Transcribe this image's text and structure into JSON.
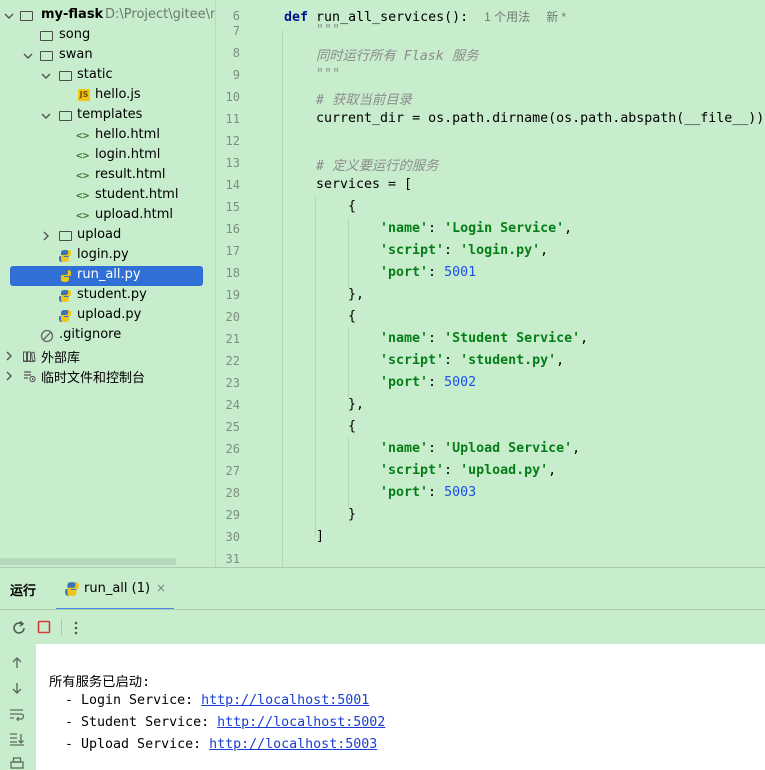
{
  "project_tree": {
    "root": {
      "name": "my-flask",
      "path": "D:\\Project\\gitee\\m"
    },
    "items": [
      {
        "name": "song",
        "type": "folder"
      },
      {
        "name": "swan",
        "type": "folder"
      },
      {
        "name": "static",
        "type": "folder"
      },
      {
        "name": "hello.js",
        "type": "js-file"
      },
      {
        "name": "templates",
        "type": "folder"
      },
      {
        "name": "hello.html",
        "type": "html-file"
      },
      {
        "name": "login.html",
        "type": "html-file"
      },
      {
        "name": "result.html",
        "type": "html-file"
      },
      {
        "name": "student.html",
        "type": "html-file"
      },
      {
        "name": "upload.html",
        "type": "html-file"
      },
      {
        "name": "upload",
        "type": "folder"
      },
      {
        "name": "login.py",
        "type": "python-file"
      },
      {
        "name": "run_all.py",
        "type": "python-file",
        "selected": true
      },
      {
        "name": "student.py",
        "type": "python-file"
      },
      {
        "name": "upload.py",
        "type": "python-file"
      },
      {
        "name": ".gitignore",
        "type": "ignore-file"
      },
      {
        "name": "外部库",
        "type": "library"
      },
      {
        "name": "临时文件和控制台",
        "type": "scratches"
      }
    ]
  },
  "editor": {
    "line_numbers": [
      "6",
      "7",
      "8",
      "9",
      "10",
      "11",
      "12",
      "13",
      "14",
      "15",
      "16",
      "17",
      "18",
      "19",
      "20",
      "21",
      "22",
      "23",
      "24",
      "25",
      "26",
      "27",
      "28",
      "29",
      "30",
      "31"
    ],
    "def_keyword": "def",
    "func_signature": "run_all_services():",
    "usage_hint": "1 个用法",
    "new_hint": "新 *",
    "docstring_open": "\"\"\"",
    "docstring_text": "同时运行所有 Flask 服务",
    "docstring_close": "\"\"\"",
    "comment_dir": "# 获取当前目录",
    "current_dir_line": "current_dir = os.path.dirname(os.path.abspath(__file__))",
    "comment_services": "# 定义要运行的服务",
    "services_open": "services = [",
    "brace_open": "{",
    "brace_close_comma": "},",
    "brace_close": "}",
    "bracket_close": "]",
    "key_name": "'name'",
    "key_script": "'script'",
    "key_port": "'port'",
    "colon": ": ",
    "comma": ",",
    "services": [
      {
        "name": "'Login Service'",
        "script": "'login.py'",
        "port": "5001"
      },
      {
        "name": "'Student Service'",
        "script": "'student.py'",
        "port": "5002"
      },
      {
        "name": "'Upload Service'",
        "script": "'upload.py'",
        "port": "5003"
      }
    ]
  },
  "run_panel": {
    "title": "运行",
    "tab_label": "run_all (1)",
    "tab_close": "×",
    "console": {
      "header": "所有服务已启动:",
      "lines": [
        {
          "prefix": "  - Login Service: ",
          "url": "http://localhost:5001"
        },
        {
          "prefix": "  - Student Service: ",
          "url": "http://localhost:5002"
        },
        {
          "prefix": "  - Upload Service: ",
          "url": "http://localhost:5003"
        }
      ]
    }
  },
  "colors": {
    "background": "#c7edcc",
    "selection": "#2f6fd6",
    "link": "#1a3fcf"
  }
}
